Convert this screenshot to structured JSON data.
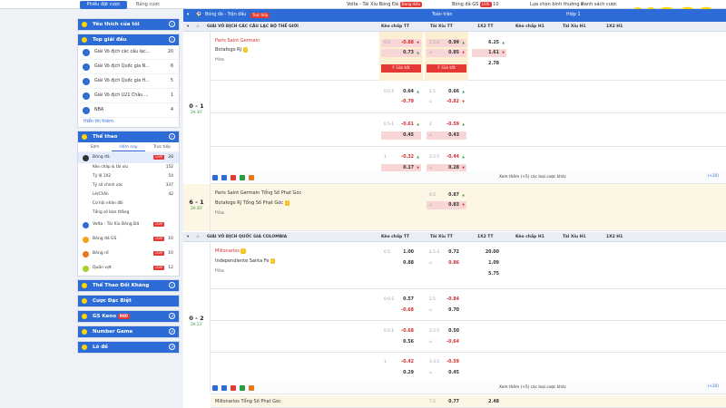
{
  "topbar": {
    "tab_active": "Phiếu đặt cược",
    "tab_2": "Bảng cược",
    "game_1": "Volta - Tài Xỉu Bóng Đá",
    "game_1_badge": "Đang diễn",
    "game_2": "Bóng đá GS",
    "game_2_count": "10",
    "sort_label": "Lựa chọn bình thường",
    "bet_list": "Danh sách cược",
    "logo": "HO88"
  },
  "sidebar": {
    "favorites_title": "Yêu thích của tôi",
    "top_title": "Top giải đấu",
    "top_leagues": [
      {
        "label": "Giải Vô địch các câu lạc...",
        "count": "20"
      },
      {
        "label": "Giải Vô địch Quốc gia N...",
        "count": "6"
      },
      {
        "label": "Giải Vô địch Quốc gia H...",
        "count": "5"
      },
      {
        "label": "Giải Vô địch U21 Châu ...",
        "count": "1"
      },
      {
        "label": "NBA",
        "count": "4"
      }
    ],
    "show_more": "Hiển thị thêm",
    "sports_title": "Thể thao",
    "sports_tabs": [
      "Sớm",
      "Hôm nay",
      "Trực tiếp"
    ],
    "football": {
      "label": "Bóng đá",
      "tag": "LIVE",
      "count": "28"
    },
    "football_sub": [
      {
        "label": "Kèo chấp & tài xỉu",
        "count": "152"
      },
      {
        "label": "Tỷ lệ 1X2",
        "count": "54"
      },
      {
        "label": "Tỷ số chính xác",
        "count": "337"
      },
      {
        "label": "Lẻ/Chẵn",
        "count": "42"
      },
      {
        "label": "Cơ hội nhân đôi",
        "count": ""
      },
      {
        "label": "Tổng số bàn thắng",
        "count": ""
      }
    ],
    "other_sports": [
      {
        "label": "Volta - Tài Xỉu Bóng Đá",
        "tag": "LIVE",
        "count": ""
      },
      {
        "label": "Bóng đá GS",
        "tag": "LIVE",
        "count": "10"
      },
      {
        "label": "Bóng rổ",
        "tag": "LIVE",
        "count": "10"
      },
      {
        "label": "Quần vợt",
        "tag": "LIVE",
        "count": "12"
      }
    ],
    "virtual_title": "Thể Thao Đối Kháng",
    "special_title": "Cược Đặc Biệt",
    "keno_title": "GS Keno",
    "keno_badge": "MỚI",
    "number_title": "Number Game",
    "lotto_title": "Lô đề"
  },
  "main": {
    "header_title": "Bóng đá - Trận đấu",
    "header_badge": "Trực tiếp",
    "header_fulltime": "Toàn trận",
    "header_half": "Hiệp 1",
    "league_1": "GIẢI VÔ ĐỊCH CÁC CÂU LẠC BỘ THẾ GIỚI",
    "league_2": "GIẢI VÔ ĐỊCH QUỐC GIA COLOMBIA",
    "col_hcp_ft": "Kèo chấp TT",
    "col_ou_ft": "Tài Xỉu TT",
    "col_1x2_ft": "1X2 TT",
    "col_hcp_h1": "Kèo chấp H1",
    "col_ou_h1": "Tài Xỉu H1",
    "col_1x2_h1": "1X2 H1",
    "match_1": {
      "score": "0 - 1",
      "time": "2H 30'",
      "home": "Paris Saint Germain",
      "away": "Botafogo RJ",
      "draw": "Hòa"
    },
    "match_1_odds": {
      "hcp_line": "0.5",
      "hcp_home": "-0.88",
      "hcp_away": "0.73",
      "ou_line": "1.5-2",
      "ou_over": "0.99",
      "ou_u": "u",
      "ou_under": "0.85",
      "x_home": "6.25",
      "x_away": "1.61",
      "x_draw": "2.78",
      "boost": "F Giá tốt"
    },
    "match_1_alt": [
      {
        "hcp_line": "0-0.5",
        "hcp_home": "0.64",
        "hcp_away": "-0.79",
        "ou_line": "1.5",
        "ou_over": "0.66",
        "ou_under": "-0.82"
      },
      {
        "hcp_line": "0.5-1",
        "hcp_home": "-0.61",
        "hcp_away": "0.45",
        "ou_line": "2",
        "ou_over": "-0.59",
        "ou_under": "0.43"
      },
      {
        "hcp_line": "1",
        "hcp_home": "-0.32",
        "hcp_away": "0.17",
        "ou_line": "2-2.5",
        "ou_over": "-0.44",
        "ou_under": "0.28"
      }
    ],
    "more_bets_1": "Xem thêm (+5) các loại cược khác",
    "more_plus_1": "(+20)",
    "corners_1": {
      "score": "6 - 1",
      "time": "2H 30'",
      "home": "Paris Saint Germain Tổng Số Phạt Góc",
      "away": "Botafogo RJ Tổng Số Phạt Góc",
      "draw": "Hòa",
      "ou_line": "9.5",
      "ou_over": "0.87",
      "ou_u": "u",
      "ou_under": "0.83"
    },
    "match_2": {
      "score": "0 - 2",
      "time": "2H 13'",
      "home": "Millonarios",
      "away": "Independiente Santa Fe",
      "draw": "Hòa"
    },
    "match_2_odds": {
      "hcp_line": "0.5",
      "hcp_home": "1.00",
      "hcp_away": "0.88",
      "ou_line": "2.5-3",
      "ou_over": "0.72",
      "ou_u": "u",
      "ou_under": "0.86",
      "x_home": "20.00",
      "x_away": "1.09",
      "x_draw": "5.75"
    },
    "match_2_alt": [
      {
        "hcp_line": "0-0.5",
        "hcp_home": "0.57",
        "hcp_away": "-0.68",
        "ou_line": "2.5",
        "ou_over": "-0.84",
        "ou_under": "0.70"
      },
      {
        "hcp_line": "0.5-1",
        "hcp_home": "-0.68",
        "hcp_away": "0.56",
        "ou_line": "2-2.5",
        "ou_over": "0.50",
        "ou_under": "-0.64"
      },
      {
        "hcp_line": "1",
        "hcp_home": "-0.42",
        "hcp_away": "0.29",
        "ou_line": "3-3.5",
        "ou_over": "-0.59",
        "ou_under": "0.45"
      }
    ],
    "more_bets_2": "Xem thêm (+5) các loại cược khác",
    "more_plus_2": "(+20)",
    "corners_2": {
      "home": "Millonarios Tổng Số Phạt Góc",
      "ou_line": "7.5",
      "ou_over": "0.77",
      "x_home": "2.48"
    }
  },
  "colors": {
    "accent": "#2d6bd6",
    "up": "#2d9b3a",
    "down": "#d32f2f",
    "logo": "#ffd600"
  }
}
